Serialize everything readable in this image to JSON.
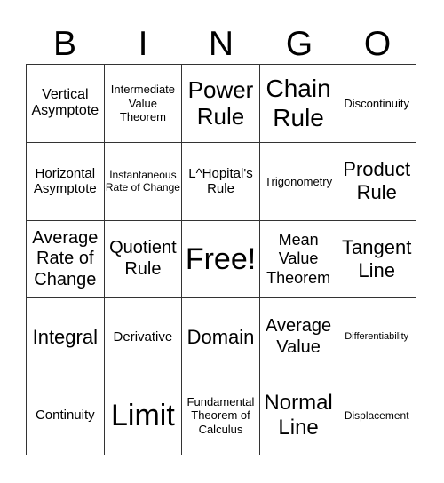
{
  "header": [
    "B",
    "I",
    "N",
    "G",
    "O"
  ],
  "cells": [
    "Vertical Asymptote",
    "Intermediate Value Theorem",
    "Power Rule",
    "Chain Rule",
    "Discontinuity",
    "Horizontal Asymptote",
    "Instantaneous Rate of Change",
    "L^Hopital's Rule",
    "Trigonometry",
    "Product Rule",
    "Average Rate of Change",
    "Quotient Rule",
    "Free!",
    "Mean Value Theorem",
    "Tangent Line",
    "Integral",
    "Derivative",
    "Domain",
    "Average Value",
    "Differentiability",
    "Continuity",
    "Limit",
    "Fundamental Theorem of Calculus",
    "Normal Line",
    "Displacement"
  ]
}
